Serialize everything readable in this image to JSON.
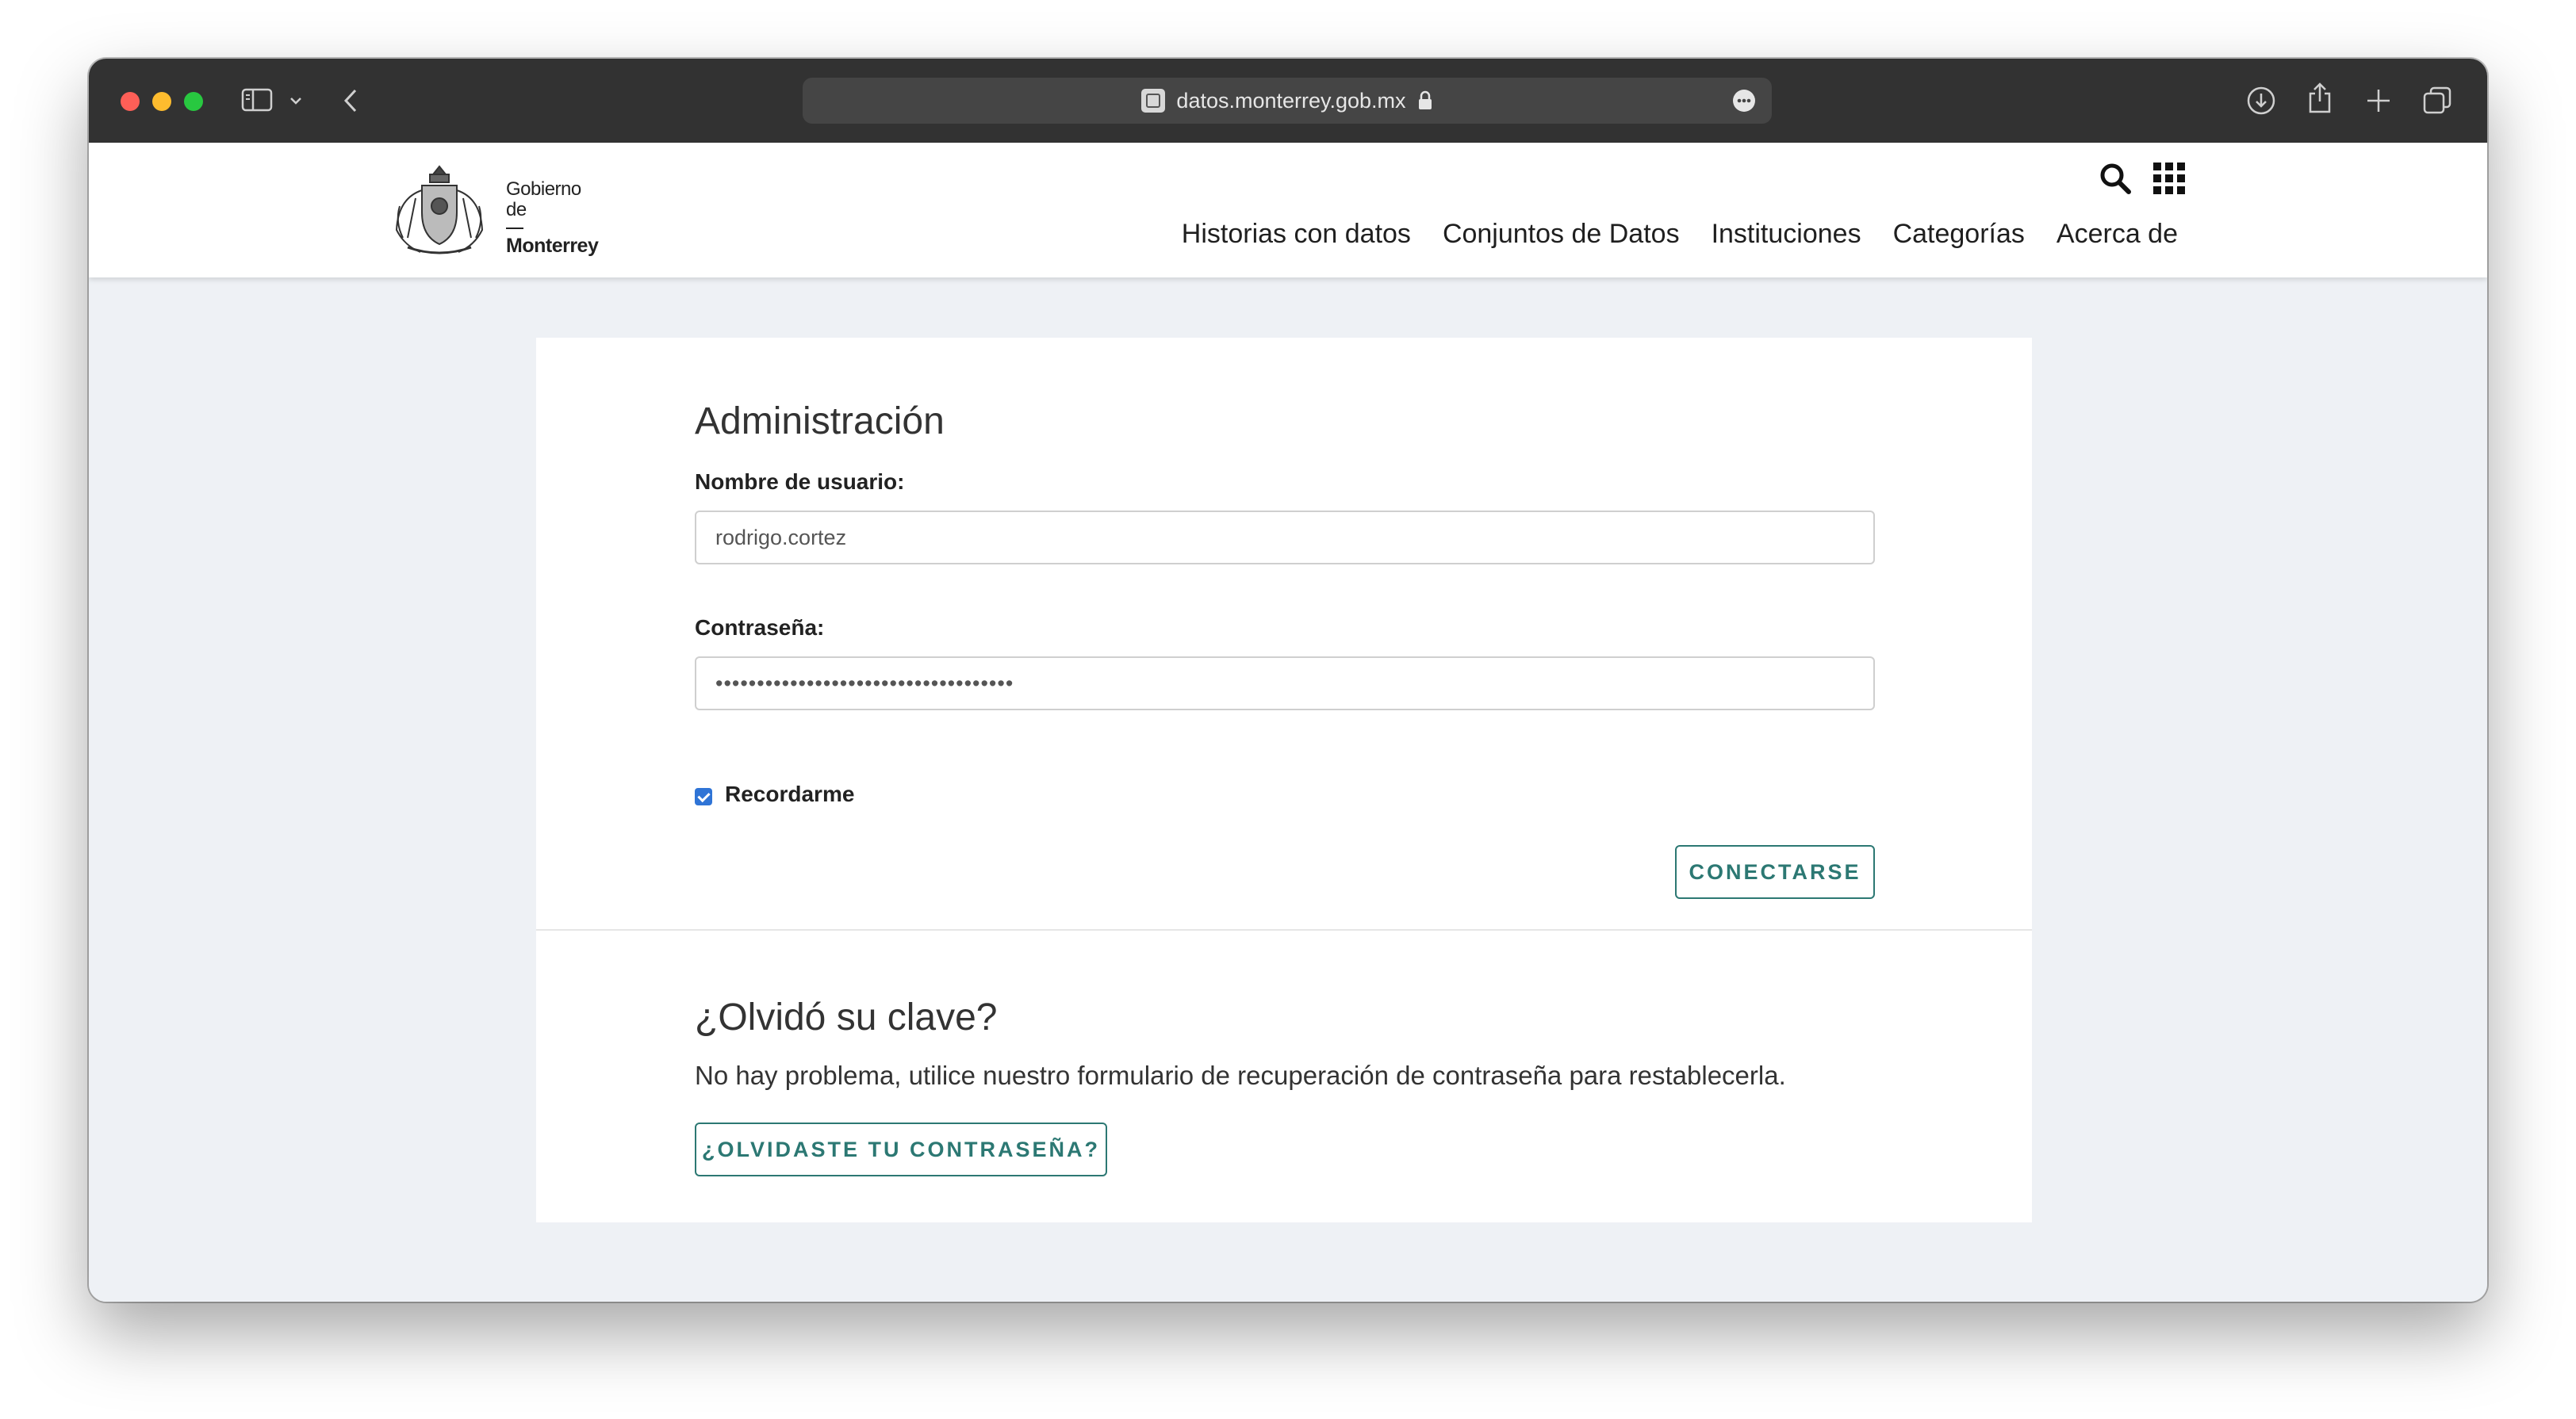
{
  "browser": {
    "url": "datos.monterrey.gob.mx",
    "colors": {
      "close": "#fe5f57",
      "minimize": "#febc2e",
      "zoom": "#28c840"
    }
  },
  "site": {
    "logo_line1": "Gobierno",
    "logo_line2": "de",
    "logo_line3": "Monterrey",
    "nav": [
      "Historias con datos",
      "Conjuntos de Datos",
      "Instituciones",
      "Categorías",
      "Acerca de"
    ]
  },
  "login": {
    "title": "Administración",
    "username_label": "Nombre de usuario:",
    "username_value": "rodrigo.cortez",
    "password_label": "Contraseña:",
    "password_value": "••••••••••••••••••••••••••••••••••••",
    "remember_label": "Recordarme",
    "remember_checked": true,
    "submit_label": "CONECTARSE"
  },
  "forgot": {
    "title": "¿Olvidó su clave?",
    "text": "No hay problema, utilice nuestro formulario de recuperación de contraseña para restablecerla.",
    "button_label": "¿OLVIDASTE TU CONTRASEÑA?"
  },
  "theme": {
    "accent": "#2c7873",
    "checkbox": "#2f74d6"
  }
}
